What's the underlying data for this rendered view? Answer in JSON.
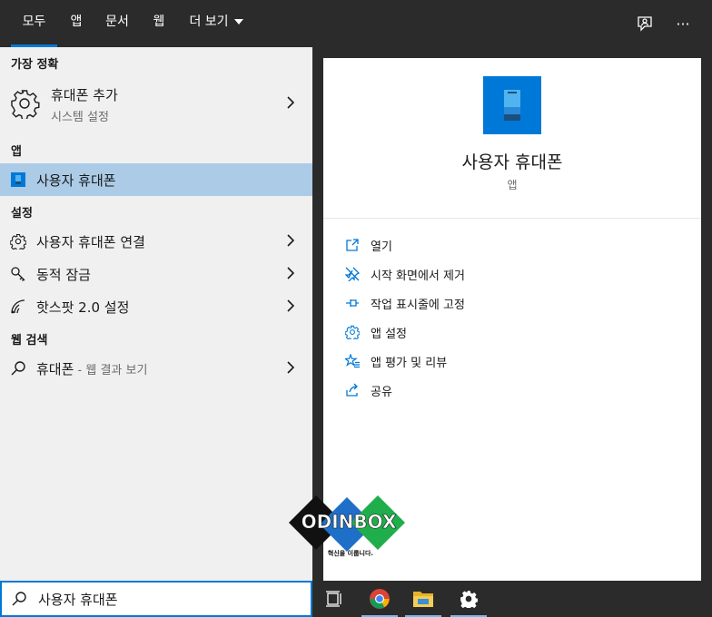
{
  "tabs": [
    {
      "label": "모두"
    },
    {
      "label": "앱"
    },
    {
      "label": "문서"
    },
    {
      "label": "웹"
    },
    {
      "label": "더 보기"
    }
  ],
  "top_icons": {
    "feedback": "feedback-icon",
    "more": "···"
  },
  "left": {
    "best_match": {
      "header": "가장 정확",
      "title": "휴대폰 추가",
      "subtitle": "시스템 설정"
    },
    "apps": {
      "header": "앱",
      "item": "사용자 휴대폰"
    },
    "settings": {
      "header": "설정",
      "items": [
        {
          "label": "사용자 휴대폰 연결"
        },
        {
          "label": "동적 잠금"
        },
        {
          "label": "핫스팟 2.0 설정"
        }
      ]
    },
    "web": {
      "header": "웹 검색",
      "query": "휴대폰",
      "suffix": " - 웹 결과 보기"
    }
  },
  "right": {
    "app_title": "사용자 휴대폰",
    "app_type": "앱",
    "actions": [
      {
        "label": "열기",
        "icon": "open-icon"
      },
      {
        "label": "시작 화면에서 제거",
        "icon": "unpin-icon"
      },
      {
        "label": "작업 표시줄에 고정",
        "icon": "pin-icon"
      },
      {
        "label": "앱 설정",
        "icon": "gear-icon"
      },
      {
        "label": "앱 평가 및 리뷰",
        "icon": "rate-icon"
      },
      {
        "label": "공유",
        "icon": "share-icon"
      }
    ]
  },
  "watermark": {
    "brand": "ODINBOX",
    "tagline": "혁신을 이룹니다."
  },
  "search": {
    "value": "사용자 휴대폰"
  },
  "colors": {
    "accent": "#0078d7",
    "selected": "#abcbe7",
    "bar": "#2b2b2b"
  }
}
